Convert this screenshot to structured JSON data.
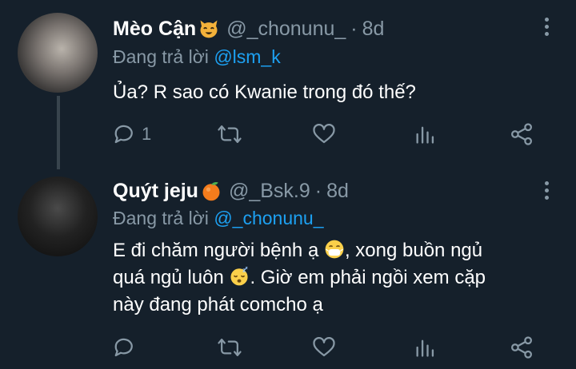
{
  "tweets": [
    {
      "name": "Mèo Cận",
      "name_emoji_icon": "cat-face-icon",
      "handle": "@_chonunu_",
      "separator": "·",
      "time": "8d",
      "replying_prefix": "Đang trả lời",
      "replying_to": "@lsm_k",
      "text": "Ủa? R sao có Kwanie trong đó thế?",
      "reply_count": "1"
    },
    {
      "name": "Quýt jeju",
      "name_emoji_icon": "tangerine-icon",
      "handle": "@_Bsk.9",
      "separator": "·",
      "time": "8d",
      "replying_prefix": "Đang trả lời",
      "replying_to": "@_chonunu_",
      "text_line1": "E đi chăm người bệnh ạ",
      "text_line1b": ", xong buồn ngủ",
      "text_line2a": "quá ngủ luôn",
      "text_line2b": ". Giờ em phải ngồi xem cặp",
      "text_line3": "này đang phát comcho ạ",
      "emoji_1": "mask-face-icon",
      "emoji_2": "sleeping-face-icon",
      "reply_count": ""
    }
  ],
  "colors": {
    "background": "#15202b",
    "secondary_text": "#8899a6",
    "accent": "#1da1f2",
    "thread_line": "#38444d"
  }
}
